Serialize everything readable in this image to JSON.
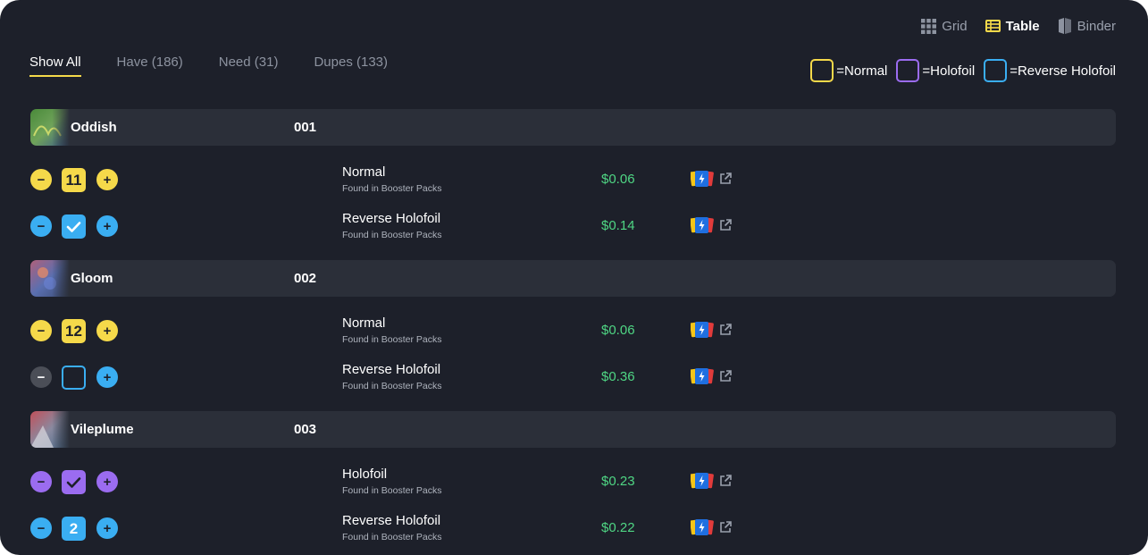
{
  "view_switch": [
    {
      "label": "Grid",
      "active": false
    },
    {
      "label": "Table",
      "active": true
    },
    {
      "label": "Binder",
      "active": false
    }
  ],
  "tabs": [
    {
      "label": "Show All",
      "active": true
    },
    {
      "label": "Have (186)",
      "active": false
    },
    {
      "label": "Need (31)",
      "active": false
    },
    {
      "label": "Dupes (133)",
      "active": false
    }
  ],
  "legend": [
    {
      "label": "=Normal",
      "color": "#f5d94a"
    },
    {
      "label": "=Holofoil",
      "color": "#9b6cf0"
    },
    {
      "label": "=Reverse Holofoil",
      "color": "#3aaef2"
    }
  ],
  "colors": {
    "normal": "#f5d94a",
    "holofoil": "#9b6cf0",
    "reverse": "#3aaef2",
    "disabled": "#4b4e57",
    "price": "#4fd684",
    "background": "#1d202a",
    "header_bg": "#2b2f39"
  },
  "cards": [
    {
      "name": "Oddish",
      "number": "001",
      "variants": [
        {
          "type": "normal",
          "name": "Normal",
          "source": "Found in Booster Packs",
          "price": "$0.06",
          "qty": "11",
          "state": "count"
        },
        {
          "type": "reverse",
          "name": "Reverse Holofoil",
          "source": "Found in Booster Packs",
          "price": "$0.14",
          "qty": "",
          "state": "checked"
        }
      ]
    },
    {
      "name": "Gloom",
      "number": "002",
      "variants": [
        {
          "type": "normal",
          "name": "Normal",
          "source": "Found in Booster Packs",
          "price": "$0.06",
          "qty": "12",
          "state": "count"
        },
        {
          "type": "reverse",
          "name": "Reverse Holofoil",
          "source": "Found in Booster Packs",
          "price": "$0.36",
          "qty": "",
          "state": "empty"
        }
      ]
    },
    {
      "name": "Vileplume",
      "number": "003",
      "variants": [
        {
          "type": "holofoil",
          "name": "Holofoil",
          "source": "Found in Booster Packs",
          "price": "$0.23",
          "qty": "",
          "state": "checked"
        },
        {
          "type": "reverse",
          "name": "Reverse Holofoil",
          "source": "Found in Booster Packs",
          "price": "$0.22",
          "qty": "2",
          "state": "count"
        }
      ]
    }
  ],
  "icons": {
    "grid": "grid-icon",
    "table": "table-icon",
    "binder": "binder-icon",
    "tcgplayer": "tcgplayer-icon",
    "external": "external-link-icon",
    "minus": "minus-icon",
    "plus": "plus-icon",
    "check": "check-icon"
  }
}
